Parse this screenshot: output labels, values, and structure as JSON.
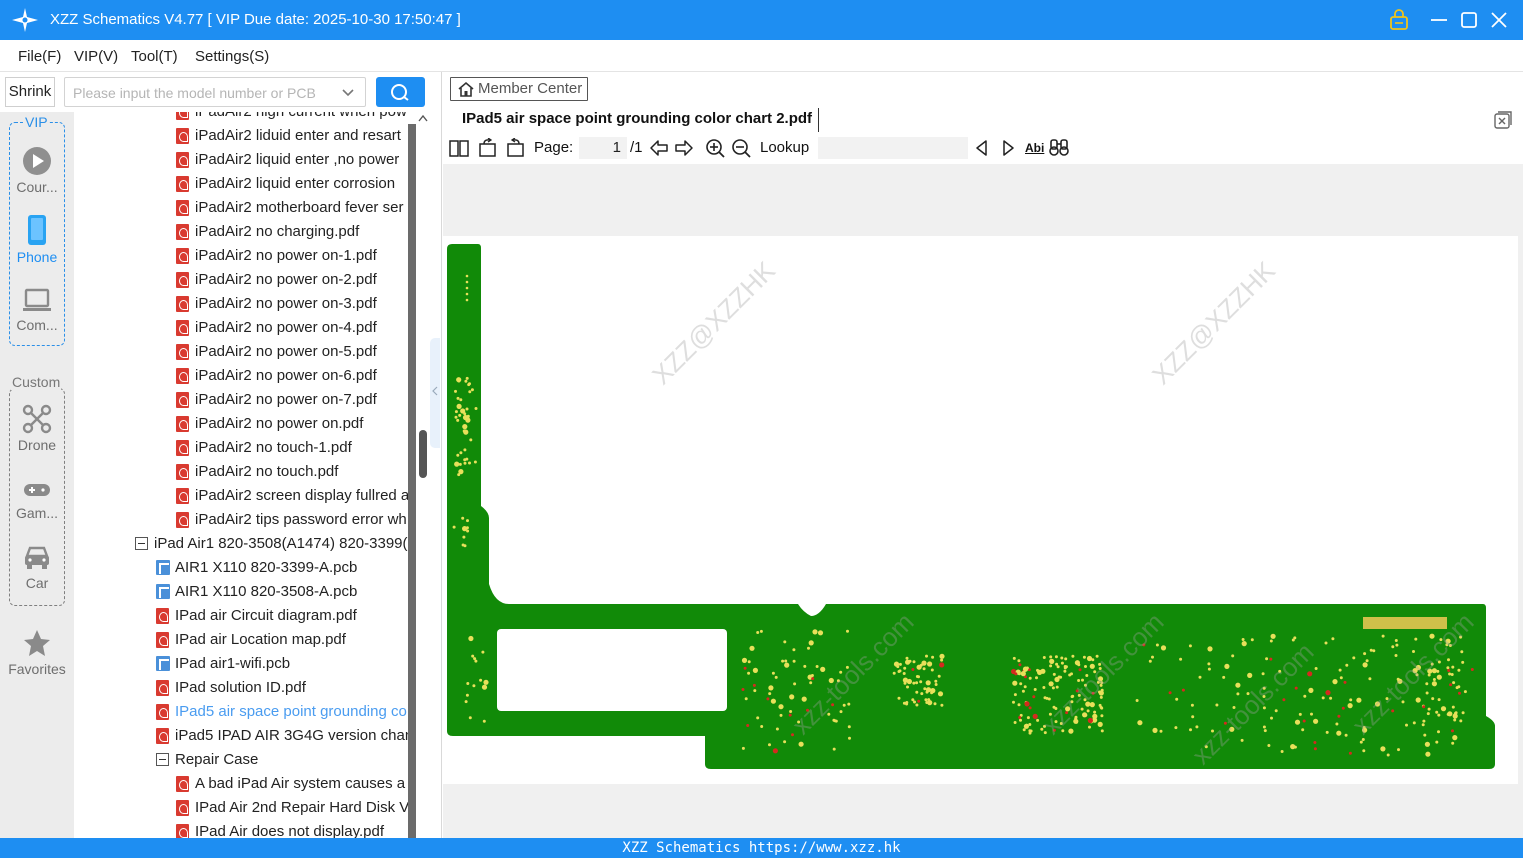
{
  "app": {
    "title": "XZZ Schematics V4.77 [ VIP Due date: 2025-10-30 17:50:47 ]"
  },
  "menu": [
    "File(F)",
    "VIP(V)",
    "Tool(T)",
    "Settings(S)"
  ],
  "left": {
    "shrink_label": "Shrink",
    "search_placeholder": "Please input the model number or PCB",
    "categories": {
      "vip_label": "VIP",
      "custom_label": "Custom",
      "items": [
        "Cour...",
        "Phone",
        "Com...",
        "Drone",
        "Gam...",
        "Car",
        "Favorites"
      ]
    },
    "tree": [
      {
        "type": "pdf",
        "label": "iPadAir2 high current when pow"
      },
      {
        "type": "pdf",
        "label": "iPadAir2 liduid enter and resart"
      },
      {
        "type": "pdf",
        "label": "iPadAir2 liquid enter ,no power"
      },
      {
        "type": "pdf",
        "label": "iPadAir2 liquid enter corrosion"
      },
      {
        "type": "pdf",
        "label": "iPadAir2 motherboard fever ser"
      },
      {
        "type": "pdf",
        "label": "iPadAir2 no charging.pdf"
      },
      {
        "type": "pdf",
        "label": "iPadAir2 no power on-1.pdf"
      },
      {
        "type": "pdf",
        "label": "iPadAir2 no power on-2.pdf"
      },
      {
        "type": "pdf",
        "label": "iPadAir2 no power on-3.pdf"
      },
      {
        "type": "pdf",
        "label": "iPadAir2 no power on-4.pdf"
      },
      {
        "type": "pdf",
        "label": "iPadAir2 no power on-5.pdf"
      },
      {
        "type": "pdf",
        "label": "iPadAir2 no power on-6.pdf"
      },
      {
        "type": "pdf",
        "label": "iPadAir2 no power on-7.pdf"
      },
      {
        "type": "pdf",
        "label": "iPadAir2 no power on.pdf"
      },
      {
        "type": "pdf",
        "label": "iPadAir2 no touch-1.pdf"
      },
      {
        "type": "pdf",
        "label": "iPadAir2 no touch.pdf"
      },
      {
        "type": "pdf",
        "label": "iPadAir2 screen display fullred a"
      },
      {
        "type": "pdf",
        "label": "iPadAir2 tips password error wh"
      },
      {
        "type": "folder",
        "label": "iPad Air1 820-3508(A1474) 820-3399("
      },
      {
        "type": "pcb",
        "label": "AIR1 X110 820-3399-A.pcb"
      },
      {
        "type": "pcb",
        "label": "AIR1 X110 820-3508-A.pcb"
      },
      {
        "type": "pdf",
        "label": "IPad air Circuit diagram.pdf"
      },
      {
        "type": "pdf",
        "label": "IPad air Location map.pdf"
      },
      {
        "type": "pcb",
        "label": "IPad air1-wifi.pcb"
      },
      {
        "type": "pdf",
        "label": "IPad solution ID.pdf"
      },
      {
        "type": "pdf",
        "label": "IPad5 air space point grounding co"
      },
      {
        "type": "pdf",
        "label": "iPad5 IPAD AIR 3G4G version chan"
      },
      {
        "type": "folder",
        "label": "Repair Case"
      },
      {
        "type": "pdf",
        "label": "A bad iPad Air system causes a"
      },
      {
        "type": "pdf",
        "label": "IPad Air 2nd Repair Hard Disk V"
      },
      {
        "type": "pdf",
        "label": "IPad Air does not display.pdf"
      }
    ]
  },
  "right": {
    "member_center": "Member Center",
    "doc_tab": "IPad5 air space point grounding color chart 2.pdf",
    "toolbar": {
      "page_label": "Page:",
      "page_value": "1",
      "page_total": "/1",
      "lookup_label": "Lookup",
      "abi_label": "Abi"
    },
    "watermarks": [
      "XZZ@XZZHK",
      "XZZ@XZZHK",
      "xzz-tools.com",
      "xzz-tools.com",
      "xzz-tools.com",
      "xzz-tools.com"
    ],
    "colors": {
      "board": "#118a08",
      "pad": "#e8e05a",
      "hot": "#d42a1e"
    }
  },
  "footer": "XZZ Schematics https://www.xzz.hk"
}
